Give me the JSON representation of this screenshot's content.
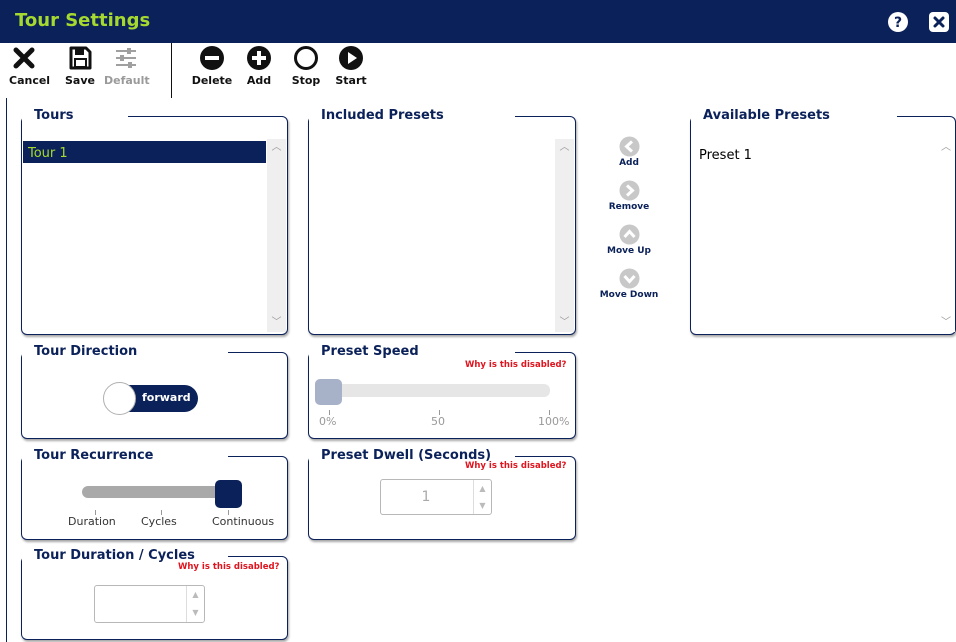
{
  "window": {
    "title": "Tour Settings"
  },
  "toolbar": {
    "cancel": "Cancel",
    "save": "Save",
    "default": "Default",
    "delete": "Delete",
    "add": "Add",
    "stop": "Stop",
    "start": "Start"
  },
  "panels": {
    "tours": {
      "title": "Tours",
      "items": [
        "Tour 1"
      ],
      "selected": "Tour 1"
    },
    "included": {
      "title": "Included Presets",
      "items": []
    },
    "available": {
      "title": "Available Presets",
      "items": [
        "Preset 1"
      ]
    },
    "direction": {
      "title": "Tour Direction",
      "toggle_label": "forward"
    },
    "speed": {
      "title": "Preset Speed",
      "disabled_note": "Why is this disabled?",
      "ticks": [
        "0%",
        "50",
        "100%"
      ],
      "value_fraction": 0
    },
    "recurrence": {
      "title": "Tour Recurrence",
      "options": [
        "Duration",
        "Cycles",
        "Continuous"
      ],
      "selected": "Continuous"
    },
    "dwell": {
      "title": "Preset Dwell (Seconds)",
      "disabled_note": "Why is this disabled?",
      "value": "1"
    },
    "duration": {
      "title": "Tour Duration / Cycles",
      "disabled_note": "Why is this disabled?",
      "value": ""
    }
  },
  "middle_buttons": {
    "add": "Add",
    "remove": "Remove",
    "move_up": "Move Up",
    "move_down": "Move Down"
  },
  "colors": {
    "navy": "#0b2159",
    "lime": "#a6d92f",
    "warning": "#e0141e",
    "disabled_gray": "#9a9a9a",
    "middle_icon_gray": "#c8c8c8"
  },
  "icons": {
    "help": "help-icon",
    "close": "close-icon",
    "cancel": "x-icon",
    "save": "floppy-disk-icon",
    "default": "sliders-icon",
    "delete": "minus-circle-icon",
    "add": "plus-circle-icon",
    "stop": "circle-outline-icon",
    "start": "play-circle-icon",
    "arrows": [
      "arrow-left-icon",
      "arrow-right-icon",
      "arrow-up-icon",
      "arrow-down-icon"
    ]
  }
}
